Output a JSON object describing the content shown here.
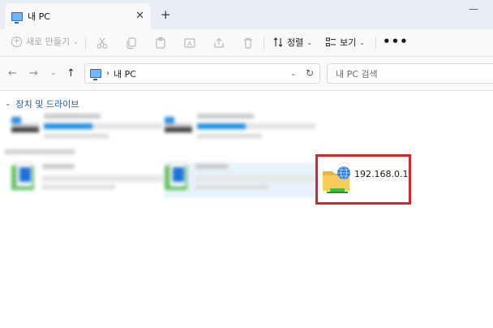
{
  "window": {
    "tab_title": "내 PC",
    "tab_close": "✕",
    "tab_add": "+",
    "minimize": "—"
  },
  "command_bar": {
    "new_label": "새로 만들기",
    "sort_label": "정렬",
    "view_label": "보기",
    "more_label": "•••",
    "icons": [
      "cut-icon",
      "copy-icon",
      "paste-icon",
      "rename-icon",
      "share-icon",
      "delete-icon"
    ]
  },
  "address": {
    "path": "내 PC",
    "separator": "›",
    "search_placeholder": "내 PC 검색"
  },
  "content": {
    "section_title": "장치 및 드라이브",
    "network_drive_label": "192.168.0.1"
  },
  "colors": {
    "accent": "#1e5aa8",
    "highlight": "#e0202a",
    "drive_bar": "#1e8fe3"
  }
}
